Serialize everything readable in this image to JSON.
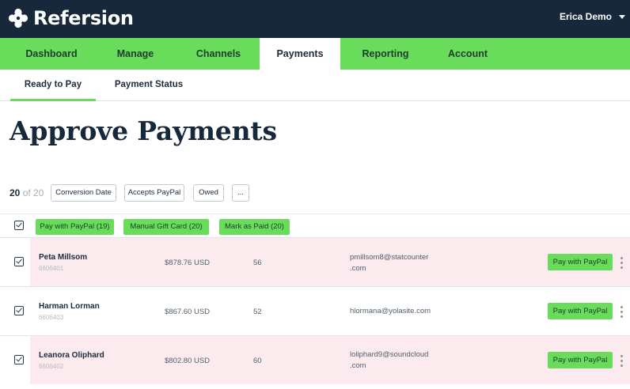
{
  "app": {
    "name": "Refersion"
  },
  "user": {
    "name": "Erica Demo"
  },
  "main_nav": [
    {
      "label": "Dashboard",
      "active": false
    },
    {
      "label": "Manage",
      "active": false
    },
    {
      "label": "Channels",
      "active": false
    },
    {
      "label": "Payments",
      "active": true
    },
    {
      "label": "Reporting",
      "active": false
    },
    {
      "label": "Account",
      "active": false
    }
  ],
  "sub_nav": [
    {
      "label": "Ready to Pay",
      "active": true
    },
    {
      "label": "Payment Status",
      "active": false
    }
  ],
  "page": {
    "title": "Approve Payments"
  },
  "summary": {
    "count": "20",
    "of_text": "of 20"
  },
  "filters": [
    "Conversion Date",
    "Accepts PayPal",
    "Owed",
    "..."
  ],
  "bulk_actions": [
    "Pay with PayPal (19)",
    "Manual Gift Card (20)",
    "Mark as Paid (20)"
  ],
  "rows": [
    {
      "name": "Peta Millsom",
      "id": "6606401",
      "amount": "$878.76 USD",
      "qty": "56",
      "email_line1": "pmillsom8@statcounter",
      "email_line2": ".com",
      "action": "Pay with PayPal",
      "checked": true
    },
    {
      "name": "Harman Lorman",
      "id": "6606403",
      "amount": "$867.60 USD",
      "qty": "52",
      "email_line1": "hlormana@yolasite.com",
      "email_line2": "",
      "action": "Pay with PayPal",
      "checked": true
    },
    {
      "name": "Leanora Oliphard",
      "id": "6606402",
      "amount": "$802.80 USD",
      "qty": "60",
      "email_line1": "loliphard9@soundcloud",
      "email_line2": ".com",
      "action": "Pay with PayPal",
      "checked": true
    }
  ],
  "colors": {
    "topbar": "#16283a",
    "accent_green": "#6adc5c",
    "row_highlight": "#fbeaee"
  }
}
